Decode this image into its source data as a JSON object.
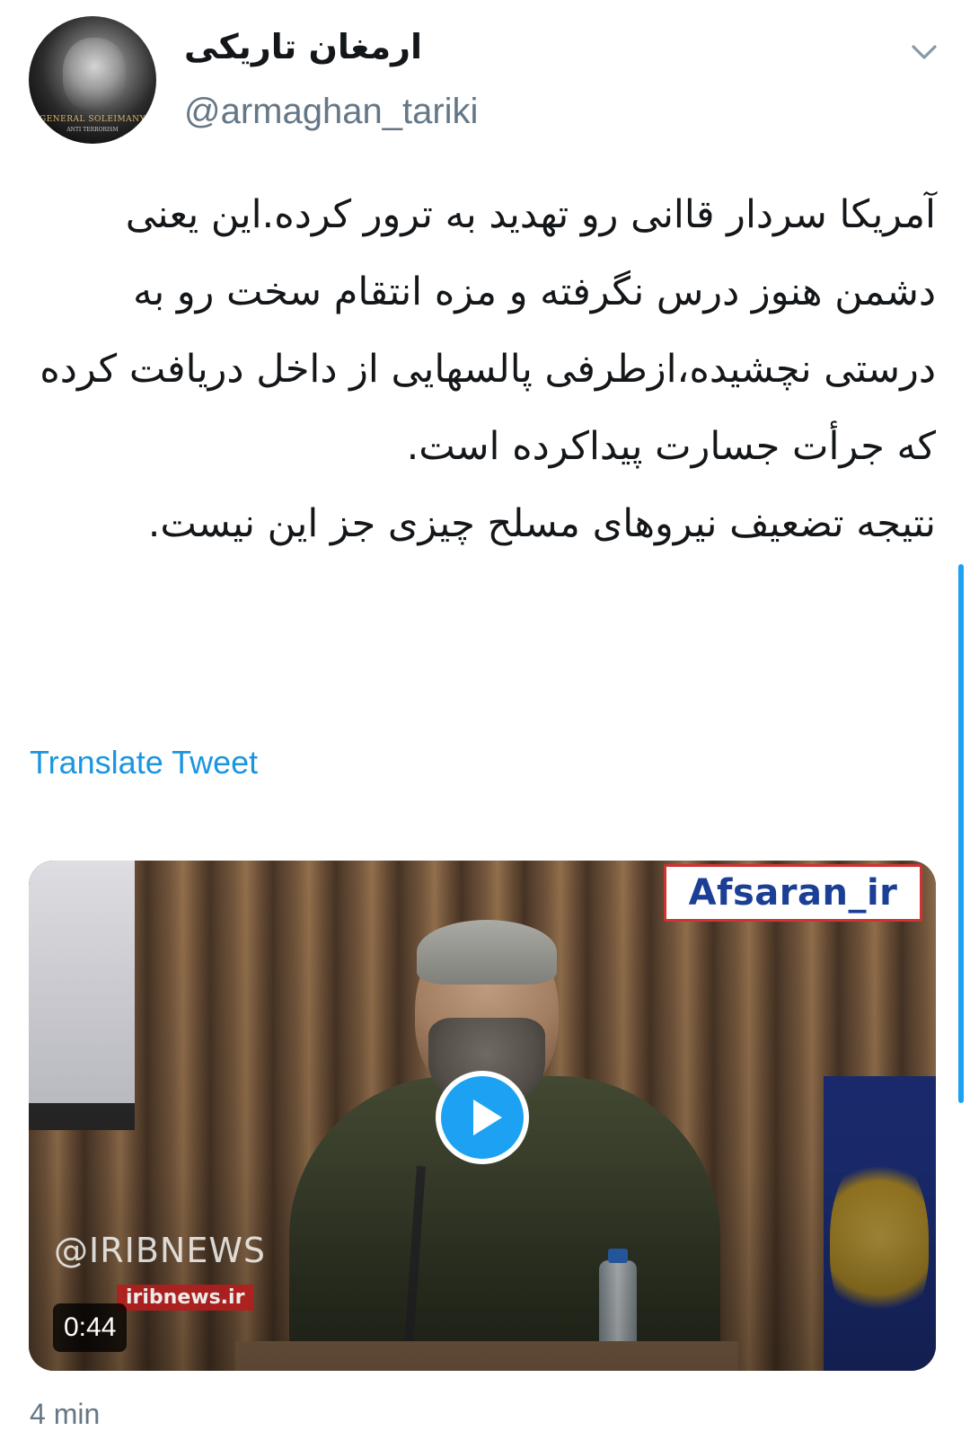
{
  "tweet": {
    "display_name": "ارمغان تاریکی",
    "handle": "@armaghan_tariki",
    "avatar": {
      "caption": "GENERAL SOLEIMANY",
      "subcaption": "ANTI TERRORISM"
    },
    "text": {
      "paragraph1": "آمریکا سردار قاانی رو تهدید به ترور کرده.این یعنی دشمن هنوز درس نگرفته و مزه انتقام سخت رو به درستی نچشیده،ازطرفی پالسهایی از داخل دریافت کرده که جرأت جسارت پیداکرده است.",
      "paragraph2": "نتیجه تضعیف نیروهای مسلح چیزی جز این نیست."
    },
    "translate_label": "Translate Tweet",
    "menu_icon": "chevron-down-icon",
    "media": {
      "type": "video",
      "duration": "0:44",
      "watermark": "Afsaran_ir",
      "overlay_handle": "@IRIBNEWS",
      "overlay_site": "iribnews.ir",
      "play_icon": "play-icon"
    },
    "footer_hint": "4 min"
  },
  "colors": {
    "link": "#1b95e0",
    "accent": "#1da1f2",
    "secondary_text": "#657786",
    "primary_text": "#14171a"
  }
}
